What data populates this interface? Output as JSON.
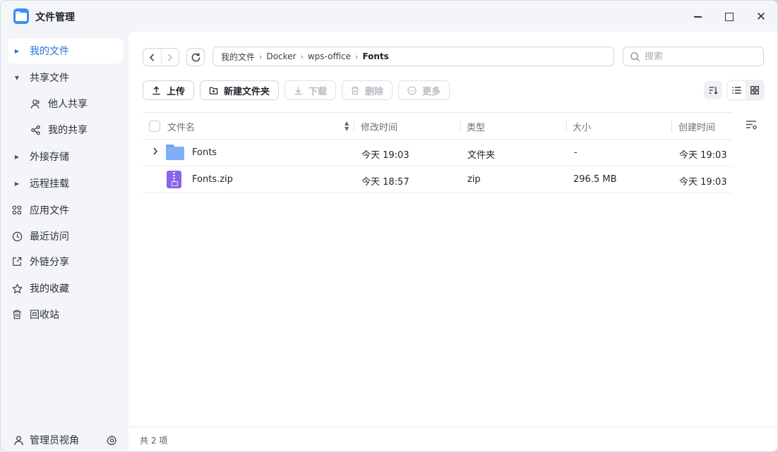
{
  "window": {
    "title": "文件管理",
    "controls": {
      "minimize": "minimize",
      "maximize": "maximize",
      "close": "✕"
    }
  },
  "sidebar": {
    "items": [
      {
        "label": "我的文件",
        "active": true,
        "expandable": true,
        "icon": "caret-right-icon"
      },
      {
        "label": "共享文件",
        "expandable": true,
        "expanded": true,
        "icon": "caret-down-icon"
      },
      {
        "label": "他人共享",
        "sub": true,
        "icon": "person-icon"
      },
      {
        "label": "我的共享",
        "sub": true,
        "icon": "share-icon"
      },
      {
        "label": "外接存储",
        "expandable": true,
        "icon": "caret-right-icon"
      },
      {
        "label": "远程挂载",
        "expandable": true,
        "icon": "caret-right-icon"
      },
      {
        "label": "应用文件",
        "icon": "apps-icon"
      },
      {
        "label": "最近访问",
        "icon": "clock-icon"
      },
      {
        "label": "外链分享",
        "icon": "external-link-icon"
      },
      {
        "label": "我的收藏",
        "icon": "star-icon"
      },
      {
        "label": "回收站",
        "icon": "trash-icon"
      }
    ],
    "footer": {
      "user_label": "管理员视角",
      "settings_icon": "gear-icon"
    }
  },
  "path": {
    "crumbs": [
      "我的文件",
      "Docker",
      "wps-office",
      "Fonts"
    ],
    "search_placeholder": "搜索"
  },
  "toolbar": {
    "upload": "上传",
    "new_folder": "新建文件夹",
    "download": "下载",
    "delete": "删除",
    "more": "更多"
  },
  "table": {
    "columns": {
      "name": "文件名",
      "modified": "修改时间",
      "type": "类型",
      "size": "大小",
      "created": "创建时间"
    },
    "rows": [
      {
        "name": "Fonts",
        "modified": "今天 19:03",
        "type": "文件夹",
        "size": "-",
        "created": "今天 19:03",
        "icon": "folder-icon"
      },
      {
        "name": "Fonts.zip",
        "modified": "今天 18:57",
        "type": "zip",
        "size": "296.5 MB",
        "created": "今天 19:03",
        "icon": "zip-file-icon"
      }
    ]
  },
  "status": {
    "count_text": "共 2 项"
  },
  "colors": {
    "accent": "#2a6fdb",
    "folder": "#7fb0f7",
    "zip": "#8a63e8",
    "sidebar_bg": "#f3f5f9"
  }
}
